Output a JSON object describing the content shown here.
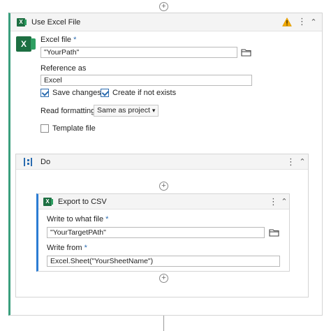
{
  "use_excel_file": {
    "title": "Use Excel File",
    "excel_file_label": "Excel file",
    "required_mark": "*",
    "excel_file_value": "\"YourPath\"",
    "reference_as_label": "Reference as",
    "reference_as_value": "Excel",
    "save_changes_label": "Save changes",
    "save_changes_checked": true,
    "create_if_not_exists_label": "Create if not exists",
    "create_if_not_exists_checked": true,
    "read_formatting_label": "Read formatting",
    "read_formatting_value": "Same as project",
    "template_file_label": "Template file",
    "template_file_checked": false
  },
  "do_sequence": {
    "title": "Do"
  },
  "export_to_csv": {
    "title": "Export to CSV",
    "write_to_label": "Write to what file",
    "write_to_value": "\"YourTargetPAth\"",
    "write_from_label": "Write from",
    "write_from_value": "Excel.Sheet(\"YourSheetName\")"
  },
  "icons": {
    "warning_color": "#f2a900",
    "excel_green": "#1d6f42",
    "accent_teal": "#3a9e7d",
    "accent_blue": "#2b7cd3"
  }
}
